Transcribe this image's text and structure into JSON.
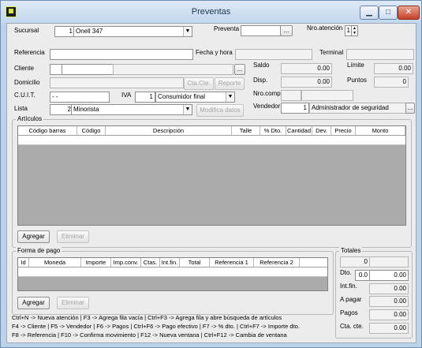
{
  "window": {
    "title": "Preventas",
    "minimize": "▁",
    "maximize": "□",
    "close": "✕"
  },
  "header": {
    "sucursal_label": "Sucursal",
    "sucursal_num": "1",
    "sucursal_name": "Onell 347",
    "preventa_label": "Preventa",
    "preventa_value": "",
    "preventa_btn": "...",
    "nro_atencion_label": "Nro.atención",
    "nro_atencion_value": "1"
  },
  "form": {
    "referencia_label": "Referencia",
    "referencia_value": "",
    "fecha_label": "Fecha y hora",
    "fecha_value": "",
    "terminal_label": "Terminal",
    "terminal_value": "",
    "cliente_label": "Cliente",
    "cliente_btn": "...",
    "saldo_label": "Saldo",
    "saldo_value": "0.00",
    "limite_label": "Límite",
    "limite_value": "0.00",
    "domicilio_label": "Domicilio",
    "cta_cte_btn": "Cta.Cte.",
    "reporte_btn": "Reporte",
    "disp_label": "Disp.",
    "disp_value": "0.00",
    "puntos_label": "Puntos",
    "puntos_value": "0",
    "cuit_label": "C.U.I.T.",
    "cuit_value": "-        -",
    "iva_label": "IVA",
    "iva_num": "1",
    "iva_name": "Consumidor final",
    "nro_comp_label": "Nro.comp.",
    "lista_label": "Lista",
    "lista_num": "2",
    "lista_name": "Minorista",
    "modifica_btn": "Modifica datos",
    "vendedor_label": "Vendedor",
    "vendedor_num": "1",
    "vendedor_name": "Administrador de seguridad",
    "vendedor_btn": "..."
  },
  "articulos": {
    "title": "Artículos",
    "columns": [
      "Código barras",
      "Código",
      "Descripción",
      "Talle",
      "% Dto.",
      "Cantidad",
      "Dev.",
      "Precio",
      "Monto"
    ],
    "agregar": "Agregar",
    "eliminar": "Eliminar"
  },
  "pago": {
    "title": "Forma de pago",
    "columns": [
      "Id",
      "Moneda",
      "Importe",
      "Imp.conv.",
      "Ctas.",
      "Int.fin.",
      "Total",
      "Referencia 1",
      "Referencia 2"
    ],
    "agregar": "Agregar",
    "eliminar": "Eliminar"
  },
  "totales": {
    "title": "Totales",
    "subtotal": "0",
    "dto_label": "Dto.",
    "dto_pct": "0.0",
    "dto_value": "0.00",
    "intfin_label": "Int.fin.",
    "intfin_value": "0.00",
    "apagar_label": "A pagar",
    "apagar_value": "0.00",
    "pagos_label": "Pagos",
    "pagos_value": "0.00",
    "ctacte_label": "Cta. cte.",
    "ctacte_value": "0.00"
  },
  "shortcuts": [
    "Ctrl+N -> Nueva atención  |  F3 -> Agrega fila vacía  |  Ctrl+F3 -> Agrega fila y abre búsqueda de artículos",
    "F4 -> Cliente  | F5 -> Vendedor  | F6 -> Pagos  | Ctrl+F6 -> Pago efectivo  | F7 -> % dto.  | Ctrl+F7 -> Importe dto.",
    "F8 -> Referencia  | F10 -> Confirma movimiento  | F12 -> Nueva ventana  | Ctrl+F12 -> Cambia de ventana"
  ]
}
